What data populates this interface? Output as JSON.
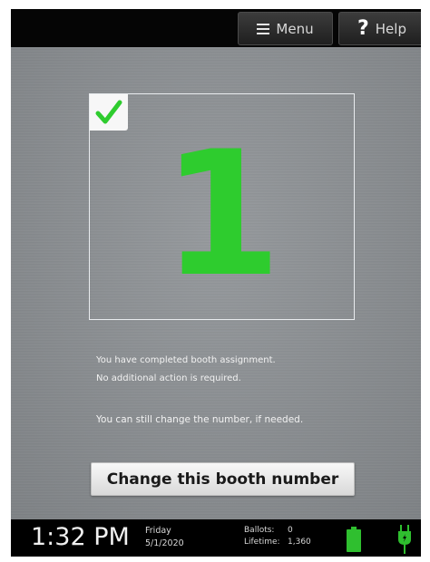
{
  "header": {
    "menu_label": "Menu",
    "help_label": "Help",
    "help_glyph": "?"
  },
  "booth": {
    "number": "1",
    "status_icon": "check-icon",
    "messages": [
      "You have completed booth assignment.",
      "No additional action is required.",
      "You can still change the number, if needed."
    ],
    "change_button_label": "Change this booth number"
  },
  "status_bar": {
    "time": "1:32 PM",
    "day": "Friday",
    "date": "5/1/2020",
    "ballots_label": "Ballots:",
    "ballots_value": "0",
    "lifetime_label": "Lifetime:",
    "lifetime_value": "1,360",
    "battery_icon": "battery-icon",
    "power_icon": "power-plug-icon"
  },
  "colors": {
    "accent_green": "#2ecc2e",
    "background_gray": "#8d9195",
    "bar_black": "#000000"
  }
}
